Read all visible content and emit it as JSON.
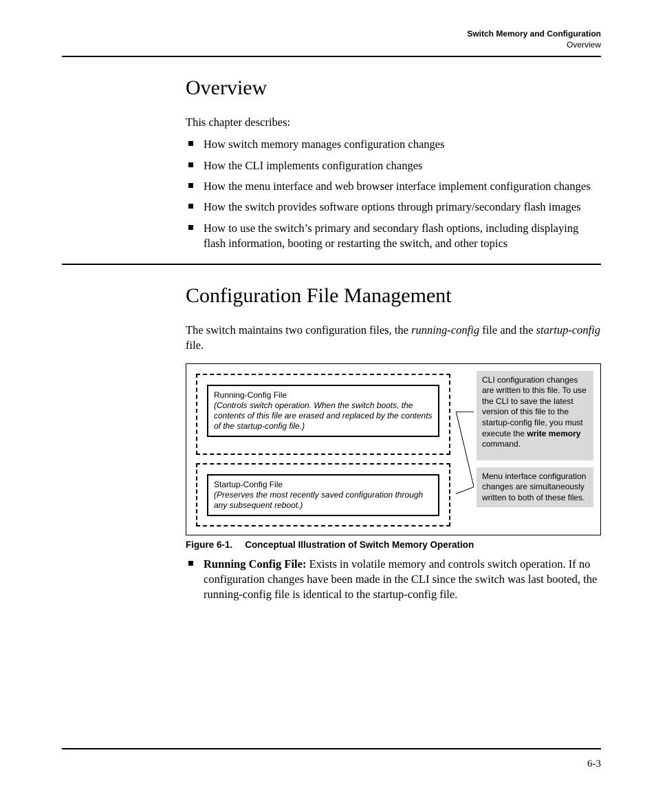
{
  "runningHeader": {
    "chapter": "Switch Memory and Configuration",
    "section": "Overview"
  },
  "section1": {
    "title": "Overview",
    "intro": "This chapter describes:",
    "bullets": [
      "How switch memory manages configuration changes",
      "How the CLI implements configuration changes",
      "How the menu interface and web browser interface implement configu­ration changes",
      "How the switch provides software options through primary/secondary flash images",
      "How to use the switch’s primary and secondary flash options, including displaying flash information, booting or restarting the switch, and other topics"
    ]
  },
  "section2": {
    "title": "Configuration File Management",
    "para_pre": "The switch maintains two configuration files, the ",
    "para_em1": "running-config",
    "para_mid": " file and the ",
    "para_em2": "startup-config",
    "para_post": " file."
  },
  "figure": {
    "running": {
      "title": "Running-Config File",
      "desc": "(Controls switch operation. When the switch boots, the contents of this file are erased and replaced by the contents of the startup-config file.)"
    },
    "startup": {
      "title": "Startup-Config File",
      "desc": "(Preserves the most recently saved configuration through any subsequent reboot.)"
    },
    "callout1_a": "CLI configuration changes are written to this file. To use the CLI to save the latest version of this file to the startup-config file, you must execute the ",
    "callout1_bold": "write memory",
    "callout1_b": " command.",
    "callout2": "Menu interface configu­ration changes are simul­taneously written to both of these files.",
    "caption_num": "Figure 6-1.",
    "caption_text": "Conceptual Illustration of Switch Memory Operation"
  },
  "afterFigure": {
    "term": "Running Config File:",
    "text": " Exists in volatile memory and controls switch operation. If no configuration changes have been made in the CLI since the switch was last booted, the running-config file is identical to the startup-config file."
  },
  "pageNumber": "6-3"
}
